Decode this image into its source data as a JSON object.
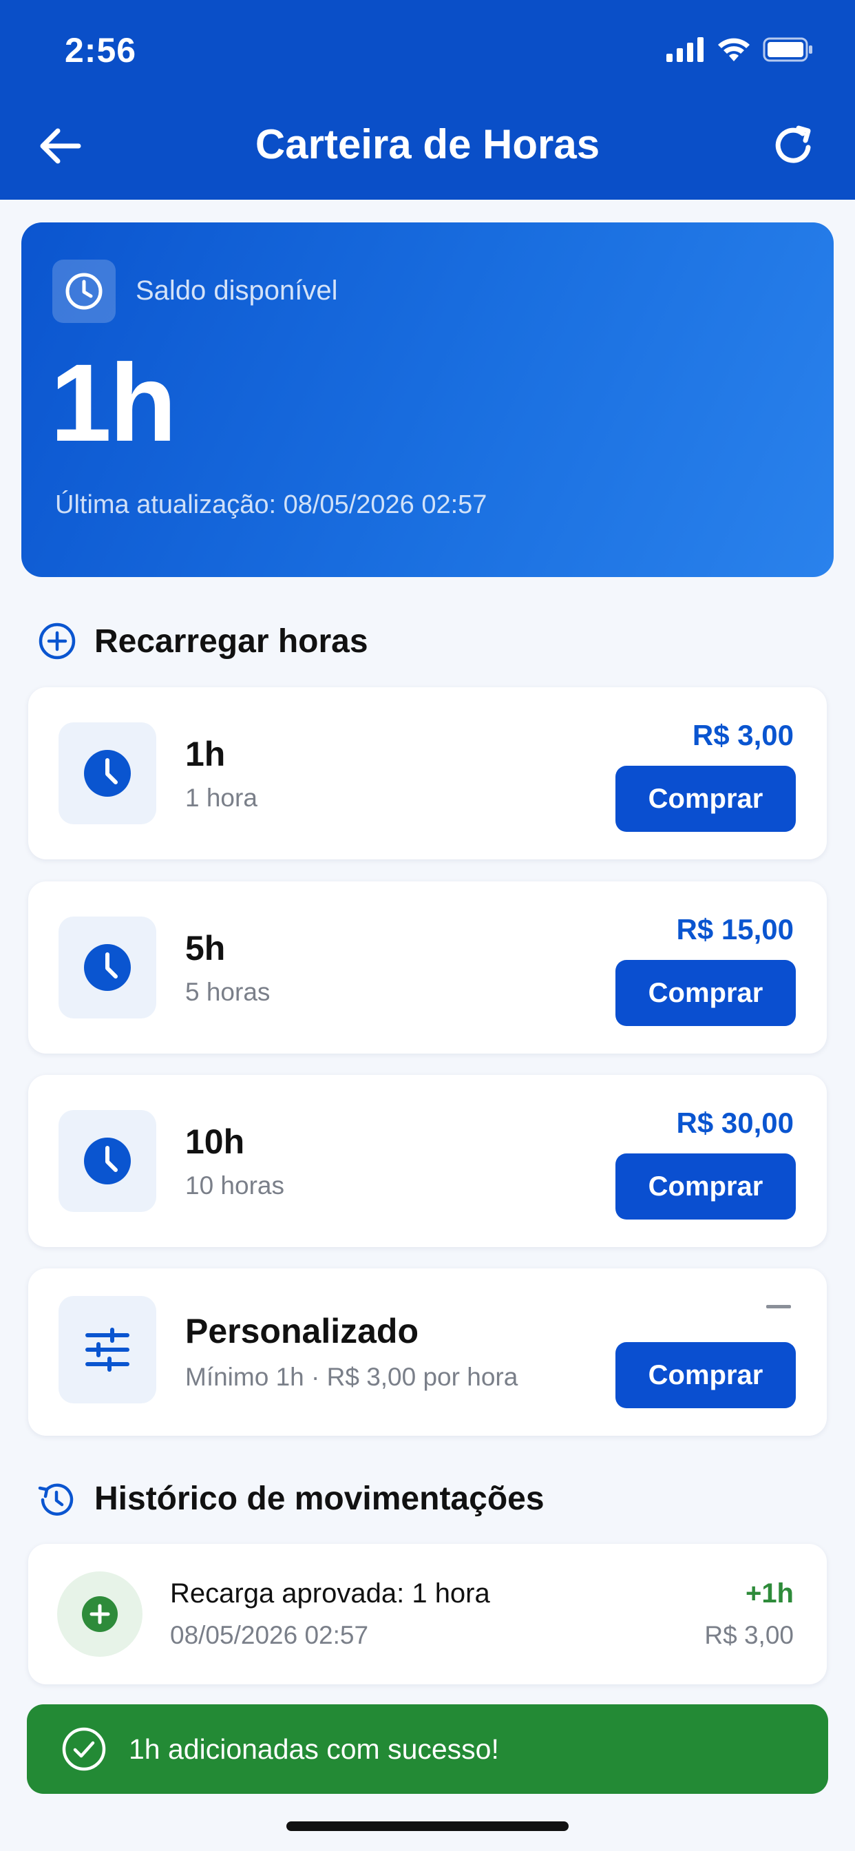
{
  "status_bar": {
    "time": "2:56"
  },
  "header": {
    "title": "Carteira de Horas"
  },
  "balance": {
    "label": "Saldo disponível",
    "value": "1h",
    "updated": "Última atualização: 08/05/2026 02:57"
  },
  "recharge": {
    "heading": "Recarregar horas",
    "packages": [
      {
        "name": "1h",
        "subtitle": "1 hora",
        "price": "R$ 3,00",
        "button": "Comprar"
      },
      {
        "name": "5h",
        "subtitle": "5 horas",
        "price": "R$ 15,00",
        "button": "Comprar"
      },
      {
        "name": "10h",
        "subtitle": "10 horas",
        "price": "R$ 30,00",
        "button": "Comprar"
      }
    ],
    "custom": {
      "name": "Personalizado",
      "subtitle": "Mínimo 1h · R$ 3,00 por hora",
      "button": "Comprar"
    }
  },
  "history": {
    "heading": "Histórico de movimentações",
    "items": [
      {
        "title": "Recarga aprovada: 1 hora",
        "date": "08/05/2026 02:57",
        "amount": "+1h",
        "price": "R$ 3,00"
      }
    ]
  },
  "toast": {
    "message": "1h adicionadas com sucesso!"
  },
  "colors": {
    "primary": "#0a4fc8",
    "success": "#238a35",
    "price": "#0a55d0"
  }
}
